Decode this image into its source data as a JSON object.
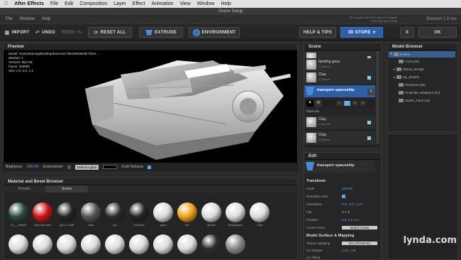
{
  "macmenu": {
    "apple": "",
    "app": "After Effects",
    "items": [
      "File",
      "Edit",
      "Composition",
      "Layer",
      "Effect",
      "Animation",
      "View",
      "Window",
      "Help"
    ]
  },
  "window": {
    "title": "Scene Setup",
    "menus": [
      "File",
      "Window",
      "Help"
    ],
    "gpu": "ATI Radeon HD 5870 OpenGL Engine\n1024 MB video RAM",
    "element": "Element 1.0.xxx"
  },
  "toolbar": {
    "import": "IMPORT",
    "undo": "UNDO",
    "redo": "REDO",
    "reset_all": "RESET ALL",
    "extrude": "EXTRUDE",
    "environment": "ENVIRONMENT",
    "help": "HELP & TIPS",
    "store": "3D STORE",
    "close": "X",
    "ok": "OK"
  },
  "preview": {
    "header": "Preview",
    "info": [
      "Model: /Users/training/Desktop/Exercise Files/Media/3D Files/...",
      "Meshes: 1",
      "Vertices: 961748",
      "Faces: 320583",
      "Size: 2.0, 0.4, 1.2"
    ]
  },
  "preview_bar": {
    "brightness_label": "Brightness",
    "brightness_value": "100.0%",
    "environment_label": "Environment",
    "lights": "Default Lights",
    "draft_textures": "Draft Textures"
  },
  "material_browser": {
    "header": "Material and Bevel Browser",
    "tabs": [
      "Presets",
      "Scene"
    ],
    "active_tab": "Scene",
    "spheres": [
      {
        "label": "DI___Default",
        "color": "#2a4a3a"
      },
      {
        "label": "illum.ado bars",
        "color": "#d01010"
      },
      {
        "label": "gun e o duff",
        "color": "#222"
      },
      {
        "label": "main",
        "color": "#555"
      },
      {
        "label": "top",
        "color": "#2a2a2a"
      },
      {
        "label": "back jets",
        "color": "#222"
      },
      {
        "label": "glass",
        "color": "#ddd"
      },
      {
        "label": "fins",
        "color": "#f0a010"
      },
      {
        "label": "gimbal",
        "color": "#ddd"
      },
      {
        "label": "landing gear",
        "color": "#ddd"
      },
      {
        "label": "Clay",
        "color": "#ddd"
      }
    ],
    "row2_colors": [
      "#ddd",
      "#ddd",
      "#ddd",
      "#ddd",
      "#ddd",
      "#ddd",
      "#ddd",
      "#ddd",
      "#2a2a2a",
      "#888"
    ]
  },
  "scene": {
    "header": "Scene",
    "items": [
      {
        "title": "",
        "sub": ""
      },
      {
        "title": "landing gear",
        "sub": "0 Textures"
      },
      {
        "title": "Clay",
        "sub": "0 Textures"
      }
    ],
    "selected": "transport spaceship",
    "sel_close": "X",
    "materials_label": "Materials",
    "mat_items": [
      {
        "title": "Clay",
        "sub": "0 Textures"
      },
      {
        "title": "Clay",
        "sub": "0 Textures"
      }
    ],
    "group_tabs": [
      "1",
      "2",
      "3",
      "4"
    ]
  },
  "edit": {
    "header": "Edit",
    "name": "transport spaceship",
    "transform": "Transform",
    "fields": [
      {
        "label": "Scale",
        "value": "100.0%"
      },
      {
        "label": "Normalize Size",
        "value": ""
      },
      {
        "label": "Orientation",
        "value": "0.0°, 0.0°, 0.0°"
      },
      {
        "label": "Flip",
        "value": "X  Y  Z"
      },
      {
        "label": "Position",
        "value": "0.0, 0.0, 0.0"
      },
      {
        "label": "Anchor Point",
        "value": "Model Center"
      }
    ],
    "mapping": "Model Surface & Mapping",
    "mapping_fields": [
      {
        "label": "Texture Mapping",
        "value": "Box (Preserve)"
      },
      {
        "label": "UV Repeat",
        "value": "1.00, 1.00"
      },
      {
        "label": "UV Offset",
        "value": ""
      }
    ]
  },
  "model_browser": {
    "header": "Model Browser",
    "root": "Models",
    "children": [
      "Icons (30)",
      "Motion_Design",
      "My_Models",
      "Primitives (54)",
      "Projectile_Weapons (57)",
      "Starter_Pack (34)"
    ]
  },
  "watermark": "lynda.com"
}
